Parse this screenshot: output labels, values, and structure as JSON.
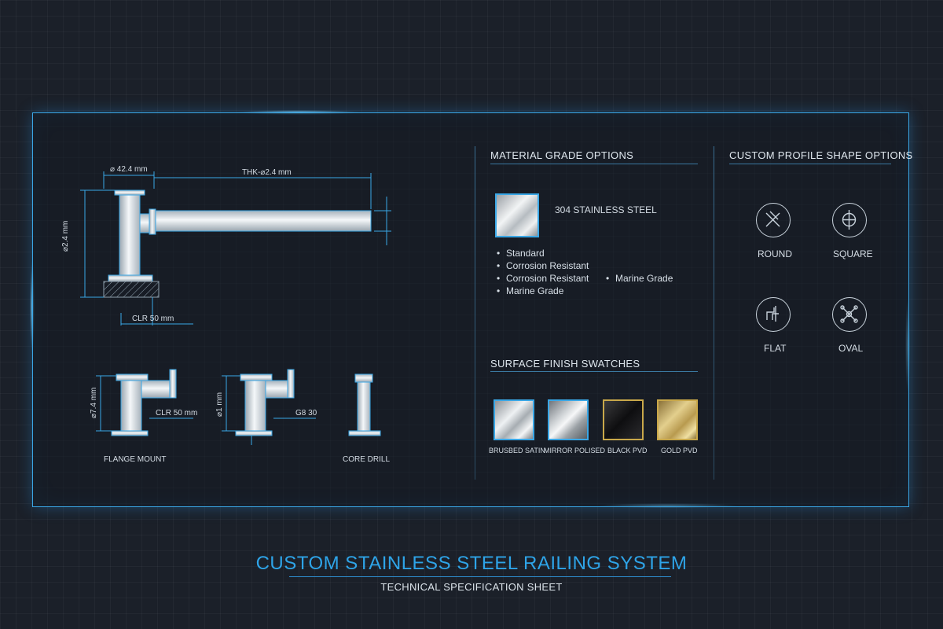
{
  "drawing": {
    "main_dims": {
      "diameter_top": "⌀ 42.4 mm",
      "thk": "THK-⌀2.4 mm",
      "height": "⌀2.4 mm",
      "clr": "CLR 50 mm"
    },
    "variants": [
      {
        "height": "⌀7.4 mm",
        "dim": "CLR 50 mm",
        "caption": "FLANGE MOUNT"
      },
      {
        "height": "⌀1 mm",
        "dim": "G8 30",
        "caption": ""
      },
      {
        "height": "",
        "dim": "",
        "caption": "CORE DRILL"
      }
    ]
  },
  "material": {
    "title": "MATERIAL GRADE OPTIONS",
    "grade": "304 STAINLESS STEEL",
    "features_col1": [
      "Standard",
      "Corrosion Resistant",
      "Corrosion Resistant",
      "Marine Grade"
    ],
    "features_col2": [
      "Marine Grade"
    ]
  },
  "finishes": {
    "title": "SURFACE FINISH SWATCHES",
    "items": [
      {
        "label": "BRUSBED SATIN",
        "color": "#cfd3d6"
      },
      {
        "label": "MIRROR POLISED",
        "color": "#b8bdc1"
      },
      {
        "label": "BLACK PVD",
        "color": "#1a1a1c"
      },
      {
        "label": "GOLD PVD",
        "color": "#d7c07a"
      }
    ]
  },
  "profiles": {
    "title": "CUSTOM PROFILE SHAPE OPTIONS",
    "items": [
      {
        "label": "ROUND",
        "icon": "round-profile-icon"
      },
      {
        "label": "SQUARE",
        "icon": "square-profile-icon"
      },
      {
        "label": "FLAT",
        "icon": "flat-profile-icon"
      },
      {
        "label": "OVAL",
        "icon": "oval-profile-icon"
      }
    ]
  },
  "footer": {
    "title": "CUSTOM STAINLESS STEEL RAILING SYSTEM",
    "subtitle": "TECHNICAL SPECIFICATION SHEET"
  },
  "colors": {
    "accent": "#2ea4e8",
    "background": "#1b2029",
    "frame": "#3aa7e6"
  }
}
